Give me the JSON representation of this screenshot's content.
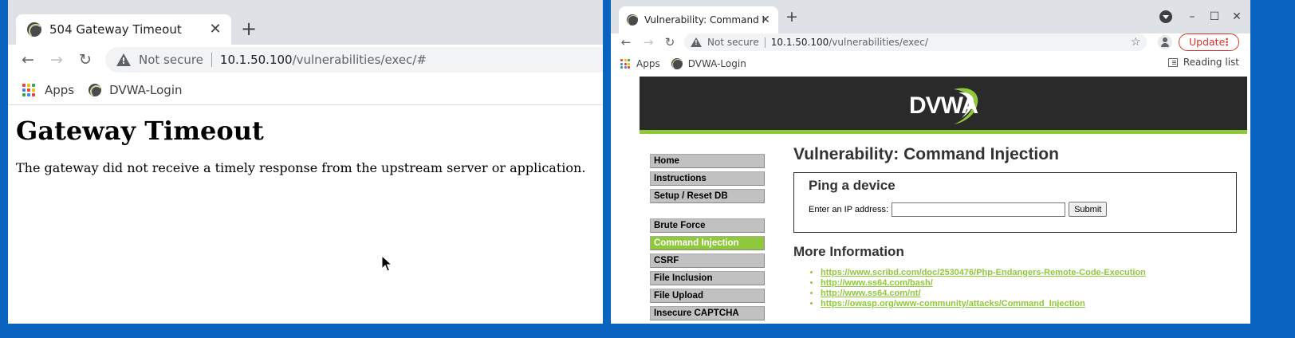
{
  "left_window": {
    "tab": {
      "title": "504 Gateway Timeout",
      "close_glyph": "✕"
    },
    "new_tab_glyph": "+",
    "nav": {
      "back": "←",
      "forward": "→",
      "reload": "↻"
    },
    "address": {
      "security": "Not secure",
      "host": "10.1.50.100",
      "path": "/vulnerabilities/exec/#"
    },
    "bookmarks": [
      {
        "label": "Apps"
      },
      {
        "label": "DVWA-Login"
      }
    ],
    "page": {
      "heading": "Gateway Timeout",
      "message": "The gateway did not receive a timely response from the upstream server or application."
    }
  },
  "right_window": {
    "tab": {
      "title": "Vulnerability: Command Injection",
      "close_glyph": "✕"
    },
    "new_tab_glyph": "+",
    "window_controls": {
      "minimize": "–",
      "maximize": "☐",
      "close": "✕"
    },
    "nav": {
      "back": "←",
      "forward": "→",
      "reload": "↻"
    },
    "address": {
      "security": "Not secure",
      "host": "10.1.50.100",
      "path": "/vulnerabilities/exec/"
    },
    "star_glyph": "☆",
    "update_button": {
      "label": "Update",
      "kebab": "⋮"
    },
    "bookmarks": [
      {
        "label": "Apps"
      },
      {
        "label": "DVWA-Login"
      }
    ],
    "reading_list": "Reading list",
    "dvwa": {
      "logo_text": "DVWA",
      "menu": [
        {
          "label": "Home"
        },
        {
          "label": "Instructions"
        },
        {
          "label": "Setup / Reset DB"
        },
        {
          "label": "Brute Force"
        },
        {
          "label": "Command Injection"
        },
        {
          "label": "CSRF"
        },
        {
          "label": "File Inclusion"
        },
        {
          "label": "File Upload"
        },
        {
          "label": "Insecure CAPTCHA"
        }
      ],
      "title": "Vulnerability: Command Injection",
      "ping": {
        "heading": "Ping a device",
        "label": "Enter an IP address:",
        "input_value": "",
        "submit": "Submit"
      },
      "more_info": {
        "heading": "More Information",
        "links": [
          "https://www.scribd.com/doc/2530476/Php-Endangers-Remote-Code-Execution",
          "http://www.ss64.com/bash/",
          "http://www.ss64.com/nt/",
          "https://owasp.org/www-community/attacks/Command_Injection"
        ]
      }
    }
  },
  "colors": {
    "desktop": "#0a63bf",
    "tabstrip": "#dee1e6",
    "dvwa_header": "#2a2a2a",
    "dvwa_accent": "#8fc83a",
    "update_red": "#d93025"
  }
}
